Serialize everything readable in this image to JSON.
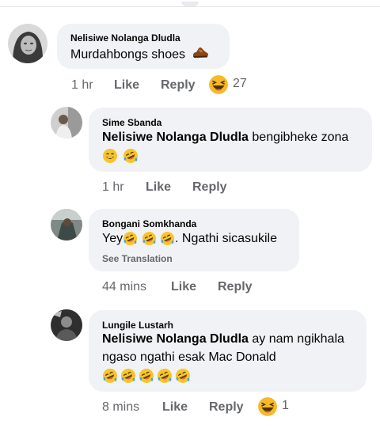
{
  "comments": [
    {
      "author": "Nelisiwe Nolanga Dludla",
      "text": "Murdahbongs shoes",
      "time": "1 hr",
      "like_label": "Like",
      "reply_label": "Reply",
      "reaction_count": "27"
    },
    {
      "author": "Sime Sbanda",
      "mention": "Nelisiwe Nolanga Dludla",
      "text": "bengibheke zona",
      "time": "1 hr",
      "like_label": "Like",
      "reply_label": "Reply"
    },
    {
      "author": "Bongani Somkhanda",
      "text_start": "Yey",
      "text_end": ". Ngathi sicasukile",
      "see_translation": "See Translation",
      "time": "44 mins",
      "like_label": "Like",
      "reply_label": "Reply"
    },
    {
      "author": "Lungile Lustarh",
      "mention": "Nelisiwe Nolanga Dludla",
      "text_line1": "ay nam ngikhala",
      "text_line2": "ngaso ngathi esak Mac Donald",
      "time": "8 mins",
      "like_label": "Like",
      "reply_label": "Reply",
      "reaction_count": "1"
    }
  ],
  "colors": {
    "bubble": "#f0f2f5",
    "meta_text": "#65676b",
    "primary_text": "#050505",
    "haha_yellow": "#f7b928"
  },
  "icons": [
    "shoe-emoji",
    "haha-reaction-icon",
    "smile-emoji",
    "rolling-laughing-emoji"
  ]
}
